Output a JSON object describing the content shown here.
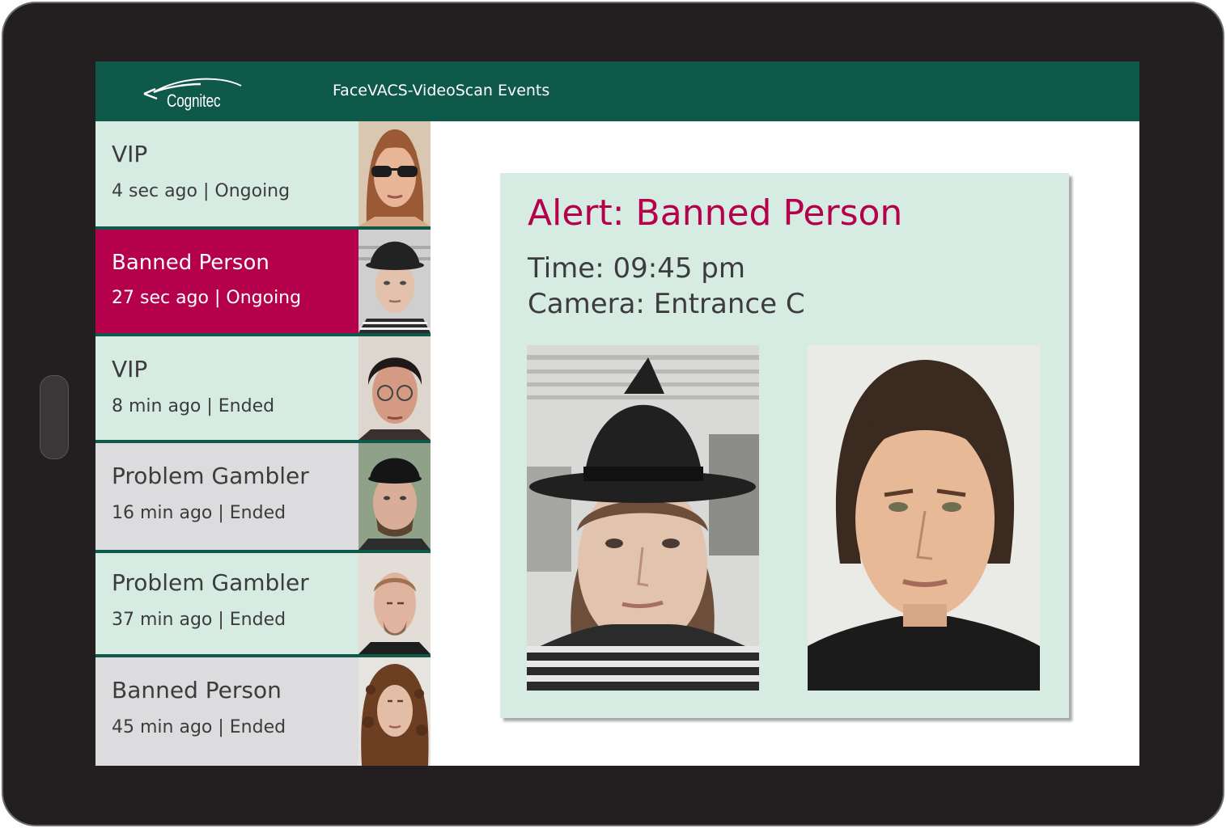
{
  "header": {
    "logo_text": "Cognitec",
    "title": "FaceVACS-VideoScan Events"
  },
  "events": [
    {
      "type": "VIP",
      "time_ago": "4 sec ago",
      "status": "Ongoing",
      "photo_icon": "face-woman-sunglasses"
    },
    {
      "type": "Banned Person",
      "time_ago": "27 sec ago",
      "status": "Ongoing",
      "photo_icon": "face-man-hat"
    },
    {
      "type": "VIP",
      "time_ago": "8 min ago",
      "status": "Ended",
      "photo_icon": "face-woman-glasses"
    },
    {
      "type": "Problem Gambler",
      "time_ago": "16 min ago",
      "status": "Ended",
      "photo_icon": "face-man-cap"
    },
    {
      "type": "Problem Gambler",
      "time_ago": "37 min ago",
      "status": "Ended",
      "photo_icon": "face-man-balding"
    },
    {
      "type": "Banned Person",
      "time_ago": "45 min ago",
      "status": "Ended",
      "photo_icon": "face-woman-curly"
    }
  ],
  "event_subtitles": [
    "4 sec ago | Ongoing",
    "27 sec ago | Ongoing",
    "8 min ago | Ended",
    "16 min ago | Ended",
    "37 min ago | Ended",
    "45 min ago | Ended"
  ],
  "selected_event_index": 1,
  "alert": {
    "title": "Alert: Banned Person",
    "time_line": "Time: 09:45 pm",
    "camera_line": "Camera: Entrance C",
    "live_photo_icon": "live-capture-photo",
    "reference_photo_icon": "reference-photo"
  },
  "colors": {
    "header_bg": "#0f594b",
    "alert_accent": "#b5004c",
    "card_bg": "#d6ebe2",
    "ended_row_bg": "#dcdcde"
  }
}
